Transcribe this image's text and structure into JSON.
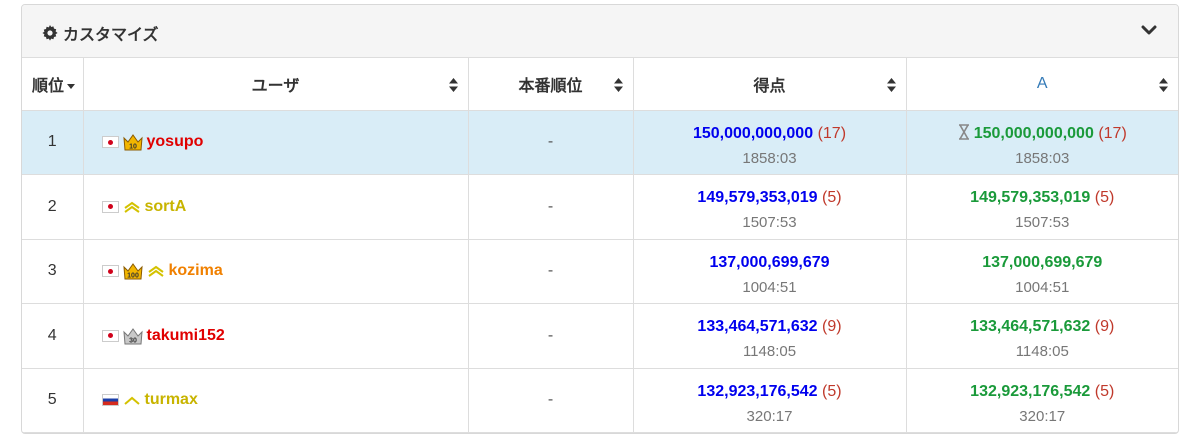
{
  "panel": {
    "title": "カスタマイズ"
  },
  "table": {
    "headers": {
      "rank": "順位",
      "user": "ユーザ",
      "official_rank": "本番順位",
      "score": "得点",
      "problem_a": "A"
    },
    "rows": [
      {
        "rank": "1",
        "flag": "jp",
        "badges": [
          "crown-10"
        ],
        "user": "yosupo",
        "user_color": "#e00000",
        "official_rank": "-",
        "score": "150,000,000,000",
        "score_penalty": "(17)",
        "time": "1858:03",
        "a_pending": true,
        "a_score": "150,000,000,000",
        "a_penalty": "(17)",
        "a_time": "1858:03",
        "a_color": "#1a9a3a",
        "highlight": true
      },
      {
        "rank": "2",
        "flag": "jp",
        "badges": [
          "chevron-double"
        ],
        "user": "sortA",
        "user_color": "#c8b400",
        "official_rank": "-",
        "score": "149,579,353,019",
        "score_penalty": "(5)",
        "time": "1507:53",
        "a_pending": false,
        "a_score": "149,579,353,019",
        "a_penalty": "(5)",
        "a_time": "1507:53",
        "highlight": false
      },
      {
        "rank": "3",
        "flag": "jp",
        "badges": [
          "crown-100",
          "chevron-double"
        ],
        "user": "kozima",
        "user_color": "#f08000",
        "official_rank": "-",
        "score": "137,000,699,679",
        "score_penalty": "",
        "time": "1004:51",
        "a_pending": false,
        "a_score": "137,000,699,679",
        "a_penalty": "",
        "a_time": "1004:51",
        "highlight": false
      },
      {
        "rank": "4",
        "flag": "jp",
        "badges": [
          "crown-30-silver"
        ],
        "user": "takumi152",
        "user_color": "#e00000",
        "official_rank": "-",
        "score": "133,464,571,632",
        "score_penalty": "(9)",
        "time": "1148:05",
        "a_pending": false,
        "a_score": "133,464,571,632",
        "a_penalty": "(9)",
        "a_time": "1148:05",
        "highlight": false
      },
      {
        "rank": "5",
        "flag": "ru",
        "badges": [
          "chevron-single"
        ],
        "user": "turmax",
        "user_color": "#c8b400",
        "official_rank": "-",
        "score": "132,923,176,542",
        "score_penalty": "(5)",
        "time": "320:17",
        "a_pending": false,
        "a_score": "132,923,176,542",
        "a_penalty": "(5)",
        "a_time": "320:17",
        "highlight": false
      }
    ]
  },
  "crown_labels": {
    "crown-10": "10",
    "crown-100": "100",
    "crown-30-silver": "30"
  }
}
